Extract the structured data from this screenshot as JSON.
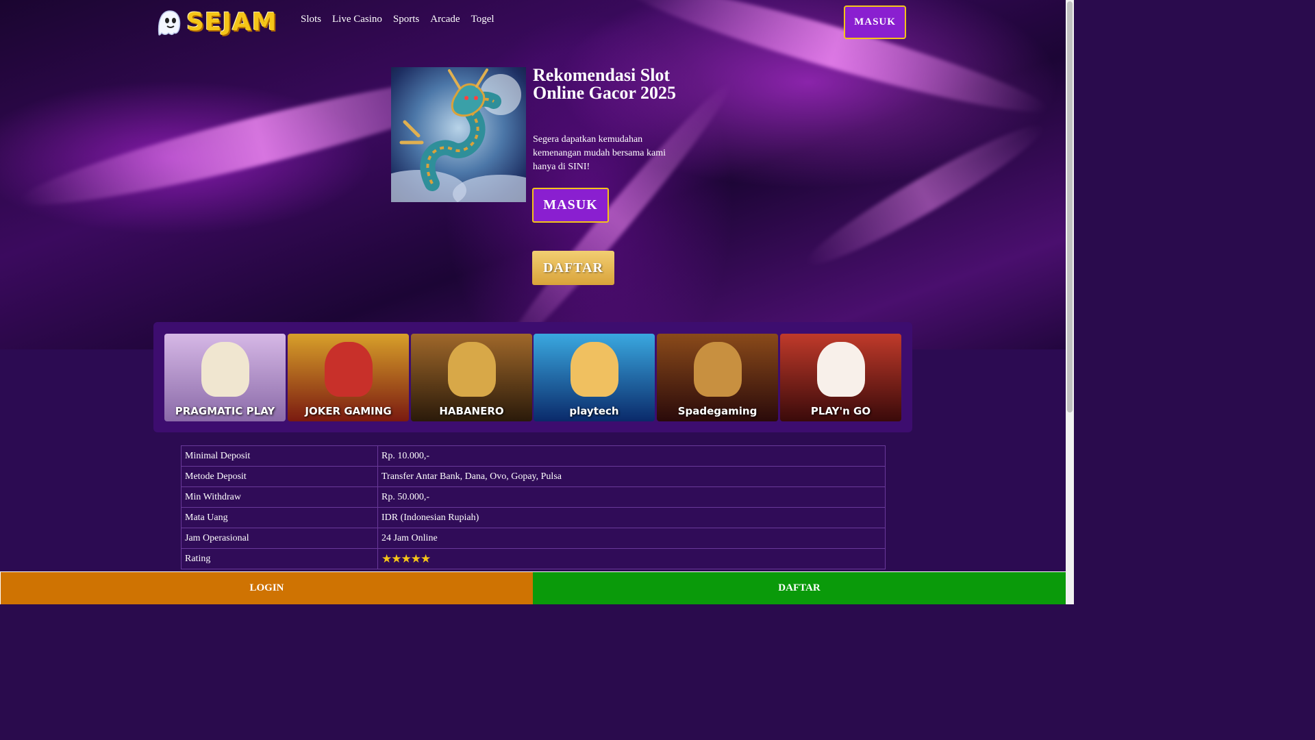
{
  "brand": {
    "logo_text": "SEJAM"
  },
  "nav": {
    "items": [
      {
        "label": "Slots"
      },
      {
        "label": "Live Casino"
      },
      {
        "label": "Sports"
      },
      {
        "label": "Arcade"
      },
      {
        "label": "Togel"
      }
    ],
    "masuk_label": "MASUK"
  },
  "hero": {
    "title": "Rekomendasi Slot Online Gacor 2025",
    "description": "Segera dapatkan kemudahan kemenangan mudah bersama kami hanya di SINI!",
    "masuk_label": "MASUK",
    "daftar_label": "DAFTAR"
  },
  "providers": [
    {
      "name": "PRAGMATIC PLAY",
      "color": "#c9a6d8"
    },
    {
      "name": "JOKER GAMING",
      "color": "#b23a2a"
    },
    {
      "name": "HABANERO",
      "color": "#5a3a1e"
    },
    {
      "name": "playtech",
      "color": "#1f6fb0"
    },
    {
      "name": "Spadegaming",
      "color": "#5a2a12"
    },
    {
      "name": "PLAY'n GO",
      "color": "#8a1a1a"
    }
  ],
  "info": {
    "rows": [
      {
        "key": "Minimal Deposit",
        "value": "Rp. 10.000,-"
      },
      {
        "key": "Metode Deposit",
        "value": "Transfer Antar Bank, Dana, Ovo, Gopay, Pulsa"
      },
      {
        "key": "Min Withdraw",
        "value": "Rp. 50.000,-"
      },
      {
        "key": "Mata Uang",
        "value": "IDR (Indonesian Rupiah)"
      },
      {
        "key": "Jam Operasional",
        "value": "24 Jam Online"
      }
    ],
    "rating_key": "Rating",
    "rating_stars": "★★★★★",
    "rating_value": 5
  },
  "bottom_bar": {
    "login_label": "LOGIN",
    "daftar_label": "DAFTAR"
  },
  "colors": {
    "accent_gold": "#f5c518",
    "login_orange": "#cf7302",
    "daftar_green": "#0a9a0a",
    "purple_bg": "#2c0b52"
  }
}
